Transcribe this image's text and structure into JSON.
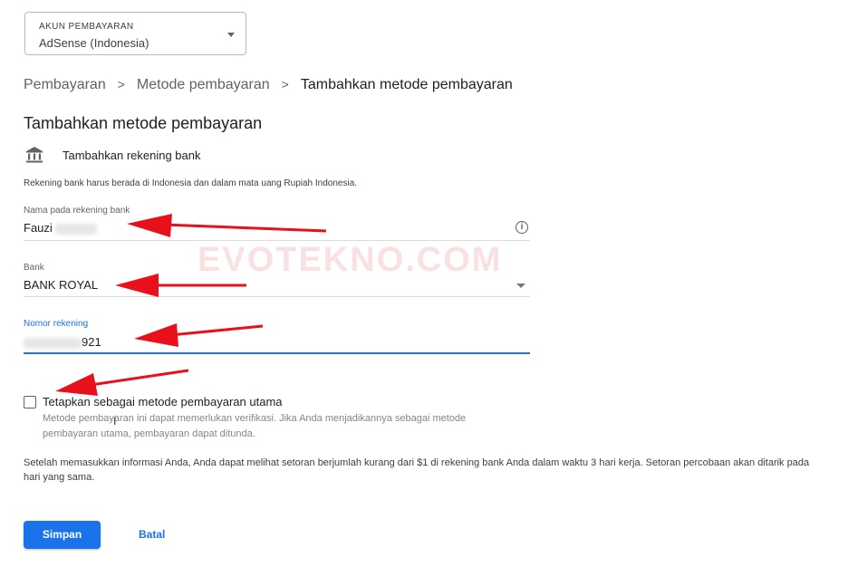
{
  "account": {
    "label": "AKUN PEMBAYARAN",
    "value": "AdSense (Indonesia)"
  },
  "breadcrumb": {
    "items": [
      "Pembayaran",
      "Metode pembayaran",
      "Tambahkan metode pembayaran"
    ],
    "separator": ">"
  },
  "page_title": "Tambahkan metode pembayaran",
  "bank_section": {
    "heading": "Tambahkan rekening bank",
    "icon": "bank-icon"
  },
  "info_text": "Rekening bank harus berada di Indonesia dan dalam mata uang Rupiah Indonesia.",
  "fields": {
    "name": {
      "label": "Nama pada rekening bank",
      "value": "Fauzi"
    },
    "bank": {
      "label": "Bank",
      "value": "BANK ROYAL"
    },
    "account_number": {
      "label": "Nomor rekening",
      "value": "921"
    }
  },
  "checkbox": {
    "label": "Tetapkan sebagai metode pembayaran utama",
    "help": "Metode pembayaran ini dapat memerlukan verifikasi. Jika Anda menjadikannya sebagai metode pembayaran utama, pembayaran dapat ditunda.",
    "checked": false
  },
  "footer_text": "Setelah memasukkan informasi Anda, Anda dapat melihat setoran berjumlah kurang dari $1 di rekening bank Anda dalam waktu 3 hari kerja. Setoran percobaan akan ditarik pada hari yang sama.",
  "buttons": {
    "save": "Simpan",
    "cancel": "Batal"
  },
  "watermark": "EVOTEKNO.COM",
  "colors": {
    "accent": "#1a73e8",
    "annotation_arrow": "#e8101a"
  }
}
